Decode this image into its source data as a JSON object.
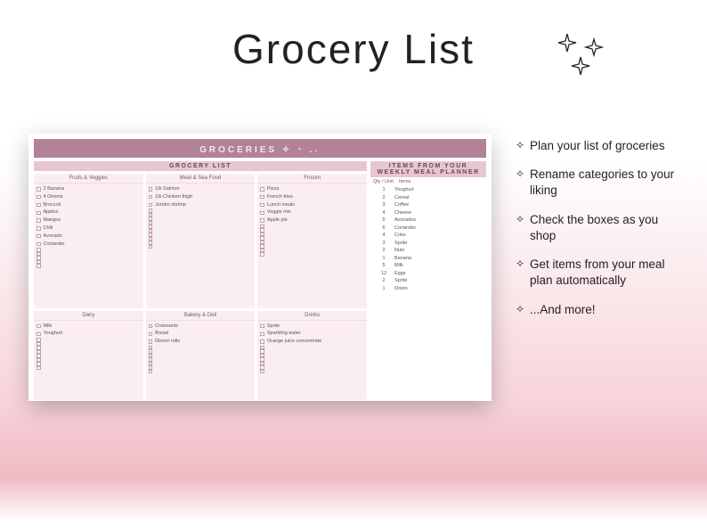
{
  "title": "Grocery List",
  "features": [
    "Plan your list of groceries",
    "Rename categories to your liking",
    "Check the boxes as you shop",
    "Get items from your meal plan automatically",
    "...And more!"
  ],
  "sheet": {
    "header": "GROCERIES ✧ ･ .˖",
    "list_header": "GROCERY LIST",
    "planner_header": "ITEMS FROM YOUR WEEKLY MEAL PLANNER",
    "planner_cols": {
      "qty": "Qty / Unit",
      "items": "Items"
    },
    "top_row": [
      {
        "title": "Fruits & Veggies",
        "items": [
          "2 Banana",
          "4 Onions",
          "Broccoli",
          "Apples",
          "Mangos",
          "Chili",
          "Avocado",
          "Coriander"
        ],
        "blanks": 5
      },
      {
        "title": "Meat & Sea Food",
        "items": [
          "1lb Salmon",
          "1lb Chicken thigh",
          "Jumbo shrimp"
        ],
        "blanks": 10
      },
      {
        "title": "Frozen",
        "items": [
          "Pizza",
          "French fries",
          "Lunch meals",
          "Veggie mix",
          "Apple pie"
        ],
        "blanks": 8
      }
    ],
    "bottom_row": [
      {
        "title": "Dairy",
        "items": [
          "Milk",
          "Youghurt"
        ],
        "blanks": 8
      },
      {
        "title": "Bakery & Deli",
        "items": [
          "Croissants",
          "Bread",
          "Dinner rolls"
        ],
        "blanks": 7
      },
      {
        "title": "Drinks",
        "items": [
          "Sprite",
          "Sparkling water",
          "Orange juice concentrate"
        ],
        "blanks": 7
      }
    ],
    "planner_items": [
      {
        "q": "1",
        "n": "Youghurt"
      },
      {
        "q": "2",
        "n": "Cereal"
      },
      {
        "q": "3",
        "n": "Coffee"
      },
      {
        "q": "4",
        "n": "Cheese"
      },
      {
        "q": "5",
        "n": "Avocados"
      },
      {
        "q": "6",
        "n": "Coriander"
      },
      {
        "q": "4",
        "n": "Coke"
      },
      {
        "q": "3",
        "n": "Sprite"
      },
      {
        "q": "2",
        "n": "Nuts"
      },
      {
        "q": "1",
        "n": "Banana"
      },
      {
        "q": "5",
        "n": "Milk"
      },
      {
        "q": "12",
        "n": "Eggs"
      },
      {
        "q": "2",
        "n": "Sprite"
      },
      {
        "q": "1",
        "n": "Onion"
      }
    ]
  }
}
